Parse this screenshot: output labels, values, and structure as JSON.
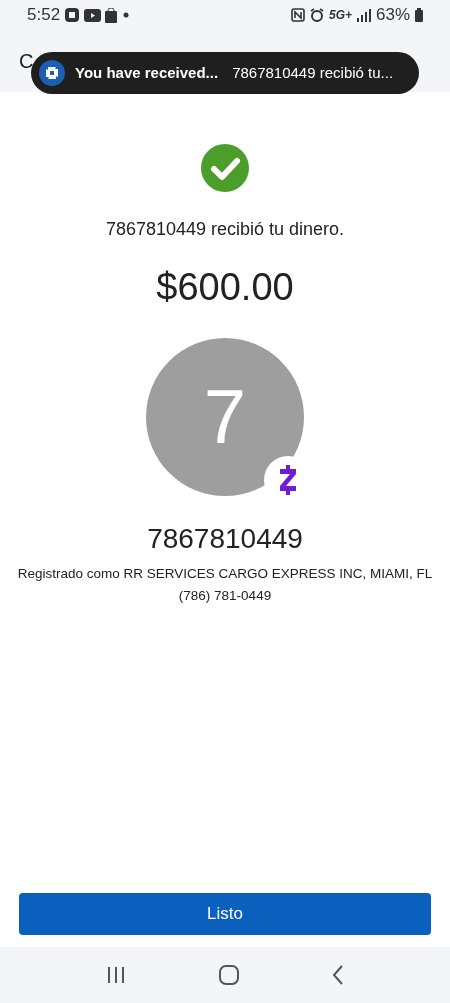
{
  "status_bar": {
    "time": "5:52",
    "network": "5G+",
    "battery": "63%"
  },
  "header": {
    "title": "C"
  },
  "notification": {
    "title": "You have received...",
    "message": "7867810449 recibió tu..."
  },
  "confirmation": {
    "message": "7867810449 recibió tu dinero.",
    "amount": "$600.00",
    "avatar_initial": "7",
    "recipient": "7867810449",
    "registered_as": "Registrado como RR SERVICES CARGO EXPRESS INC, MIAMI, FL",
    "phone": "(786) 781-0449"
  },
  "done_button": "Listo"
}
